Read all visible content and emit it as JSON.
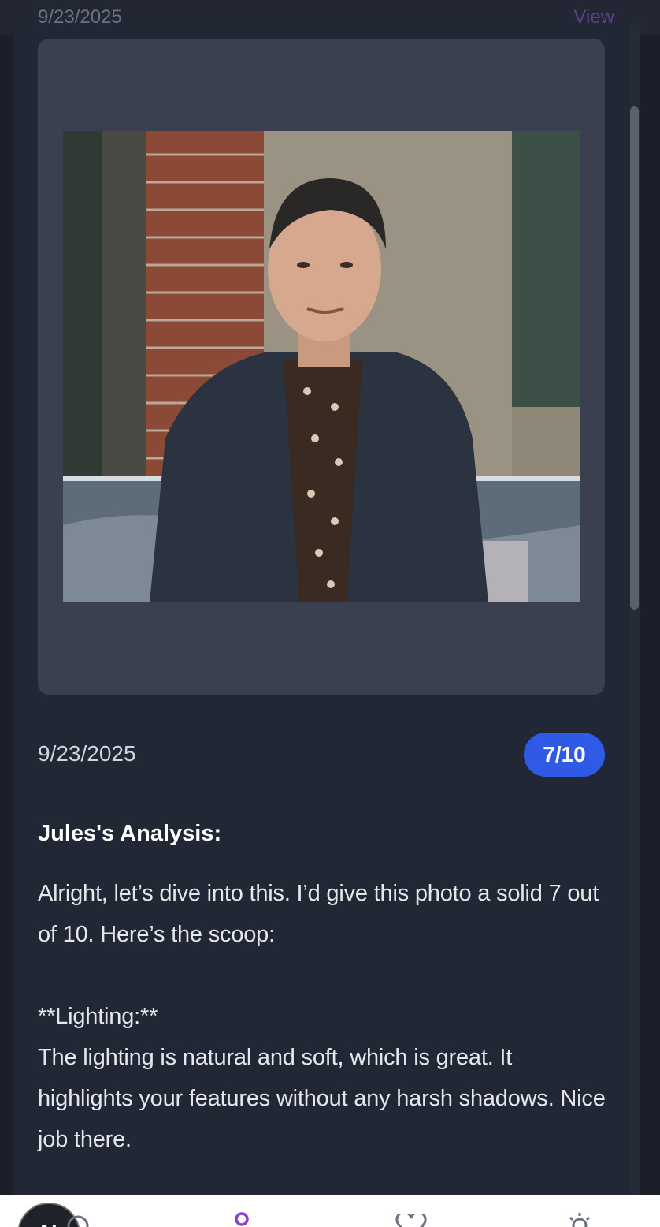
{
  "header": {
    "date": "9/23/2025",
    "view_label": "View"
  },
  "detail": {
    "date": "9/23/2025",
    "score": "7/10",
    "analysis_title": "Jules's Analysis:",
    "analysis_body": "Alright, let’s dive into this. I’d give this photo a solid 7 out of 10. Here’s the scoop:\n\n**Lighting:**\nThe lighting is natural and soft, which is great. It highlights your features without any harsh shadows. Nice job there."
  },
  "nav": {
    "avatar_initial": "N",
    "items": [
      "clock-icon",
      "person-icon",
      "heart-icon",
      "sun-icon"
    ]
  },
  "colors": {
    "accent": "#2f5ae6",
    "view_link": "#5a3f8f",
    "active_nav": "#8b3fd9"
  }
}
